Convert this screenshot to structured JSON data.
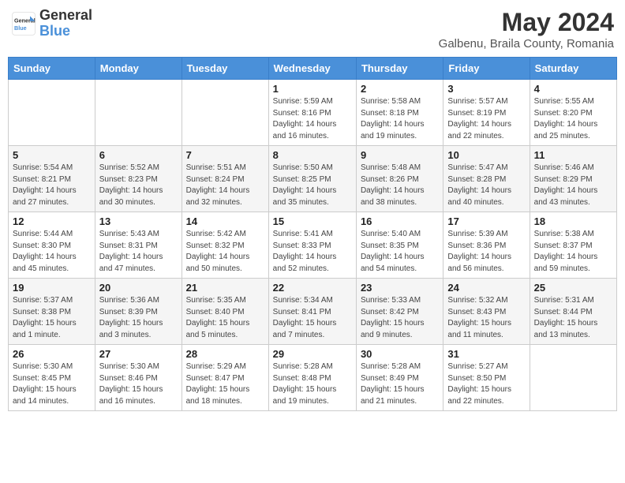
{
  "header": {
    "logo_general": "General",
    "logo_blue": "Blue",
    "month_title": "May 2024",
    "location": "Galbenu, Braila County, Romania"
  },
  "days_of_week": [
    "Sunday",
    "Monday",
    "Tuesday",
    "Wednesday",
    "Thursday",
    "Friday",
    "Saturday"
  ],
  "weeks": [
    [
      {
        "day": "",
        "info": ""
      },
      {
        "day": "",
        "info": ""
      },
      {
        "day": "",
        "info": ""
      },
      {
        "day": "1",
        "info": "Sunrise: 5:59 AM\nSunset: 8:16 PM\nDaylight: 14 hours\nand 16 minutes."
      },
      {
        "day": "2",
        "info": "Sunrise: 5:58 AM\nSunset: 8:18 PM\nDaylight: 14 hours\nand 19 minutes."
      },
      {
        "day": "3",
        "info": "Sunrise: 5:57 AM\nSunset: 8:19 PM\nDaylight: 14 hours\nand 22 minutes."
      },
      {
        "day": "4",
        "info": "Sunrise: 5:55 AM\nSunset: 8:20 PM\nDaylight: 14 hours\nand 25 minutes."
      }
    ],
    [
      {
        "day": "5",
        "info": "Sunrise: 5:54 AM\nSunset: 8:21 PM\nDaylight: 14 hours\nand 27 minutes."
      },
      {
        "day": "6",
        "info": "Sunrise: 5:52 AM\nSunset: 8:23 PM\nDaylight: 14 hours\nand 30 minutes."
      },
      {
        "day": "7",
        "info": "Sunrise: 5:51 AM\nSunset: 8:24 PM\nDaylight: 14 hours\nand 32 minutes."
      },
      {
        "day": "8",
        "info": "Sunrise: 5:50 AM\nSunset: 8:25 PM\nDaylight: 14 hours\nand 35 minutes."
      },
      {
        "day": "9",
        "info": "Sunrise: 5:48 AM\nSunset: 8:26 PM\nDaylight: 14 hours\nand 38 minutes."
      },
      {
        "day": "10",
        "info": "Sunrise: 5:47 AM\nSunset: 8:28 PM\nDaylight: 14 hours\nand 40 minutes."
      },
      {
        "day": "11",
        "info": "Sunrise: 5:46 AM\nSunset: 8:29 PM\nDaylight: 14 hours\nand 43 minutes."
      }
    ],
    [
      {
        "day": "12",
        "info": "Sunrise: 5:44 AM\nSunset: 8:30 PM\nDaylight: 14 hours\nand 45 minutes."
      },
      {
        "day": "13",
        "info": "Sunrise: 5:43 AM\nSunset: 8:31 PM\nDaylight: 14 hours\nand 47 minutes."
      },
      {
        "day": "14",
        "info": "Sunrise: 5:42 AM\nSunset: 8:32 PM\nDaylight: 14 hours\nand 50 minutes."
      },
      {
        "day": "15",
        "info": "Sunrise: 5:41 AM\nSunset: 8:33 PM\nDaylight: 14 hours\nand 52 minutes."
      },
      {
        "day": "16",
        "info": "Sunrise: 5:40 AM\nSunset: 8:35 PM\nDaylight: 14 hours\nand 54 minutes."
      },
      {
        "day": "17",
        "info": "Sunrise: 5:39 AM\nSunset: 8:36 PM\nDaylight: 14 hours\nand 56 minutes."
      },
      {
        "day": "18",
        "info": "Sunrise: 5:38 AM\nSunset: 8:37 PM\nDaylight: 14 hours\nand 59 minutes."
      }
    ],
    [
      {
        "day": "19",
        "info": "Sunrise: 5:37 AM\nSunset: 8:38 PM\nDaylight: 15 hours\nand 1 minute."
      },
      {
        "day": "20",
        "info": "Sunrise: 5:36 AM\nSunset: 8:39 PM\nDaylight: 15 hours\nand 3 minutes."
      },
      {
        "day": "21",
        "info": "Sunrise: 5:35 AM\nSunset: 8:40 PM\nDaylight: 15 hours\nand 5 minutes."
      },
      {
        "day": "22",
        "info": "Sunrise: 5:34 AM\nSunset: 8:41 PM\nDaylight: 15 hours\nand 7 minutes."
      },
      {
        "day": "23",
        "info": "Sunrise: 5:33 AM\nSunset: 8:42 PM\nDaylight: 15 hours\nand 9 minutes."
      },
      {
        "day": "24",
        "info": "Sunrise: 5:32 AM\nSunset: 8:43 PM\nDaylight: 15 hours\nand 11 minutes."
      },
      {
        "day": "25",
        "info": "Sunrise: 5:31 AM\nSunset: 8:44 PM\nDaylight: 15 hours\nand 13 minutes."
      }
    ],
    [
      {
        "day": "26",
        "info": "Sunrise: 5:30 AM\nSunset: 8:45 PM\nDaylight: 15 hours\nand 14 minutes."
      },
      {
        "day": "27",
        "info": "Sunrise: 5:30 AM\nSunset: 8:46 PM\nDaylight: 15 hours\nand 16 minutes."
      },
      {
        "day": "28",
        "info": "Sunrise: 5:29 AM\nSunset: 8:47 PM\nDaylight: 15 hours\nand 18 minutes."
      },
      {
        "day": "29",
        "info": "Sunrise: 5:28 AM\nSunset: 8:48 PM\nDaylight: 15 hours\nand 19 minutes."
      },
      {
        "day": "30",
        "info": "Sunrise: 5:28 AM\nSunset: 8:49 PM\nDaylight: 15 hours\nand 21 minutes."
      },
      {
        "day": "31",
        "info": "Sunrise: 5:27 AM\nSunset: 8:50 PM\nDaylight: 15 hours\nand 22 minutes."
      },
      {
        "day": "",
        "info": ""
      }
    ]
  ]
}
